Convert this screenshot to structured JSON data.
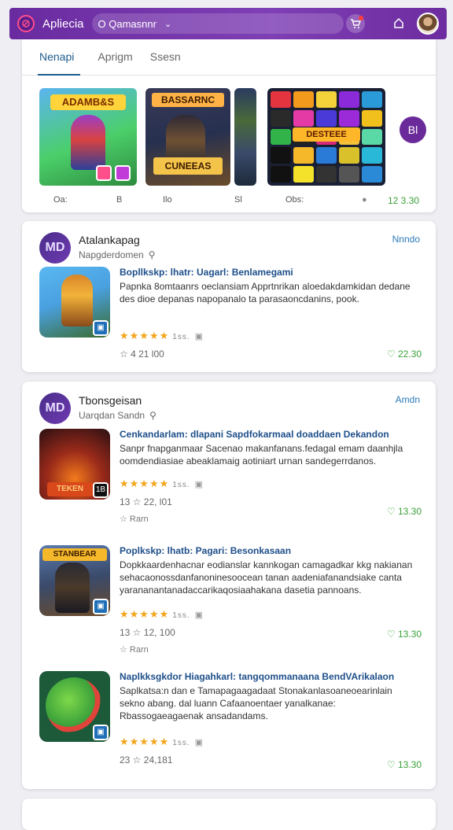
{
  "topbar": {
    "title": "Apliecia",
    "search_text": "O Qamasnnr",
    "chevron": "⌄",
    "cart_icon": "cart-icon",
    "bell_icon": "home-icon"
  },
  "tabs": [
    {
      "label": "Nenapi"
    },
    {
      "label": "Aprigm"
    },
    {
      "label": "Ssesn"
    }
  ],
  "featured": {
    "thumb1_badge": "ADAMB&S",
    "thumb2_badge": "BASSARNC",
    "thumb2_badge2": "CUNEEAS",
    "thumb4_badge": "DESTEEE",
    "chip": "Bl",
    "meta": [
      "Oa:",
      "B",
      "Ilo",
      "Sl",
      "Obs:",
      "12 3.30"
    ]
  },
  "section1": {
    "avatar_text": "MD",
    "title": "Atalankapag",
    "subtitle": "Napgderdomen",
    "more": "Nnndo",
    "app": {
      "name": "Bopllkskp: lhatr: Uagarl: Benlamegami",
      "desc": "Papnka 8omtaanrs oeclansiam Apprtnrikan aloedakdamkidan dedane des dioe depanas napopanalo ta parasaoncdanins, pook.",
      "rating_badge": "1ss.",
      "downloads": "☆ 4 21 l00",
      "price": "22.30"
    }
  },
  "section2": {
    "avatar_text": "MD",
    "title": "Tbonsgeisan",
    "subtitle": "Uarqdan Sandn",
    "more": "Amdn",
    "apps": [
      {
        "name": "Cenkandarlam: dlapani Sapdfokarmaal doaddaen Dekandon",
        "desc": "Sanpr fnapganmaar Sacenao makanfanans.fedagal emam daanhjla oomdendiasiae abeaklamaig aotiniart urnan sandegerrdanos.",
        "rating_badge": "1ss.",
        "downloads": "13 ☆ 22, l01",
        "extra": "☆ Rarn",
        "price": "13.30",
        "corner": "1B",
        "icon_badge": "TEKEN"
      },
      {
        "name": "Poplkskp: lhatb: Pagari: Besonkasaan",
        "desc": "Dopkkaardenhacnar eodianslar kannkogan camagadkar kkg nakianan sehacaonossdanfanoninesoocean tanan aadeniafanandsiake canta yarananantanadaccarikaqosiaahakana dasetia pannoans.",
        "rating_badge": "1ss.",
        "downloads": "13 ☆ 12, 100",
        "extra": "☆ Rarn",
        "price": "13.30",
        "icon_badge": "STANBEAR"
      },
      {
        "name": "Naplkksgkdor Hiagahkarl: tangqommanaana BendVArikalaon",
        "desc": "Saplkatsa:n dan e Tamapagaagadaat Stonakanlasoaneoearinlain sekno abang. dal luann Cafaanoentaer yanalkanae: Rbassogaeagaenak ansadandams.",
        "rating_badge": "1ss.",
        "downloads": "23 ☆ 24,181",
        "price": "13.30"
      }
    ]
  }
}
